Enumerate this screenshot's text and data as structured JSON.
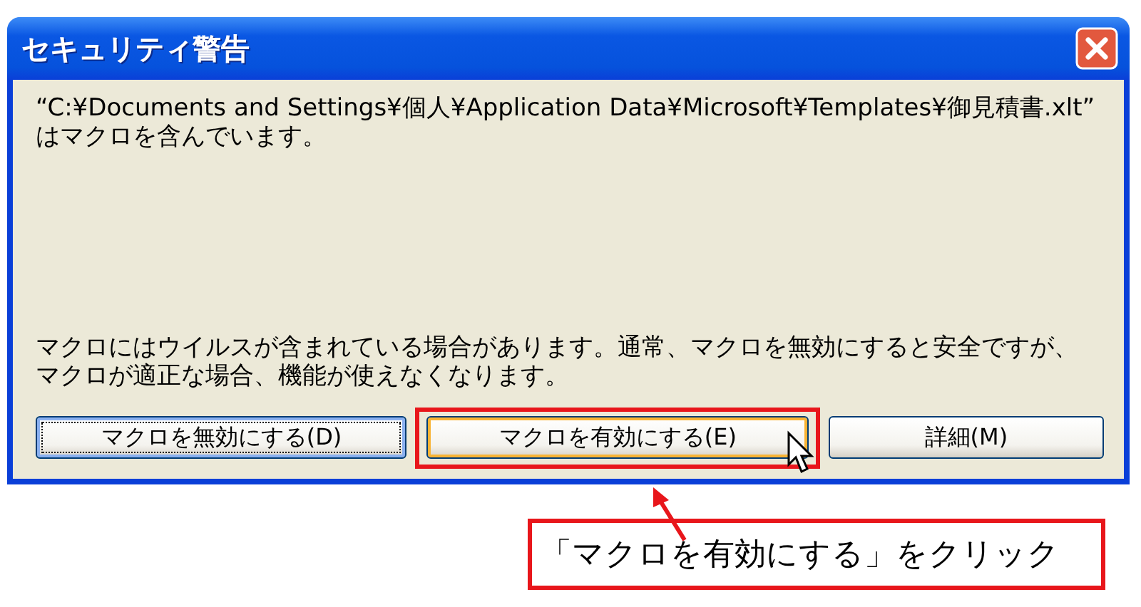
{
  "window": {
    "title": "セキュリティ警告"
  },
  "message": "“C:¥Documents and Settings¥個人¥Application Data¥Microsoft¥Templates¥御見積書.xlt” はマクロを含んでいます。",
  "warning": "マクロにはウイルスが含まれている場合があります。通常、マクロを無効にすると安全ですが、マクロが適正な場合、機能が使えなくなります。",
  "buttons": [
    {
      "label": "マクロを無効にする(D)",
      "focused": true,
      "hovered": false,
      "highlighted": false
    },
    {
      "label": "マクロを有効にする(E)",
      "focused": false,
      "hovered": true,
      "highlighted": true
    },
    {
      "label": "詳細(M)",
      "focused": false,
      "hovered": false,
      "highlighted": false
    }
  ],
  "callout": {
    "text": "「マクロを有効にする」をクリック"
  }
}
